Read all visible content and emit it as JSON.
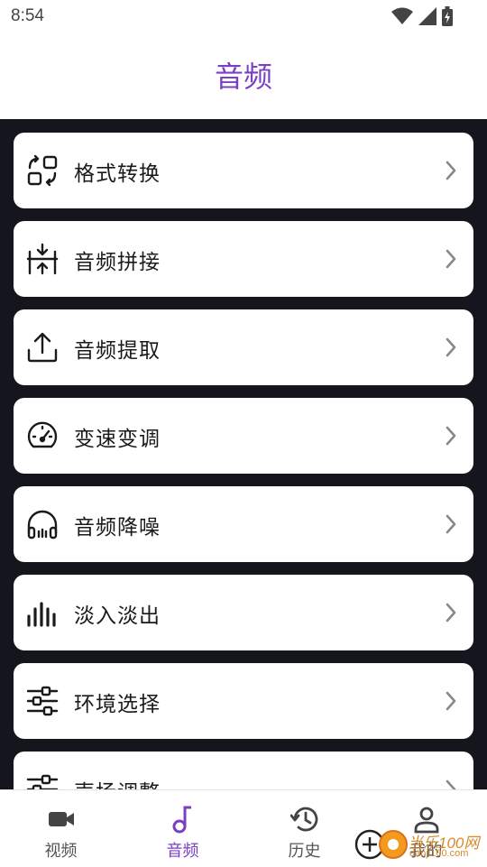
{
  "status_bar": {
    "time": "8:54"
  },
  "header": {
    "title": "音频"
  },
  "menu": {
    "items": [
      {
        "label": "格式转换",
        "icon": "format-convert-icon"
      },
      {
        "label": "音频拼接",
        "icon": "merge-icon"
      },
      {
        "label": "音频提取",
        "icon": "upload-icon"
      },
      {
        "label": "变速变调",
        "icon": "speedometer-icon"
      },
      {
        "label": "音频降噪",
        "icon": "headphones-icon"
      },
      {
        "label": "淡入淡出",
        "icon": "bars-icon"
      },
      {
        "label": "环境选择",
        "icon": "sliders-icon"
      },
      {
        "label": "声场调整",
        "icon": "sliders-icon"
      }
    ]
  },
  "bottom_nav": {
    "items": [
      {
        "label": "视频",
        "icon": "video-icon"
      },
      {
        "label": "音频",
        "icon": "music-note-icon",
        "active": true
      },
      {
        "label": "历史",
        "icon": "history-icon"
      },
      {
        "label": "我的",
        "icon": "person-icon"
      }
    ]
  },
  "watermark": {
    "text": "当乐100网",
    "sub": "danji100.com"
  },
  "colors": {
    "accent": "#7b3fc4",
    "background": "#15161d"
  }
}
